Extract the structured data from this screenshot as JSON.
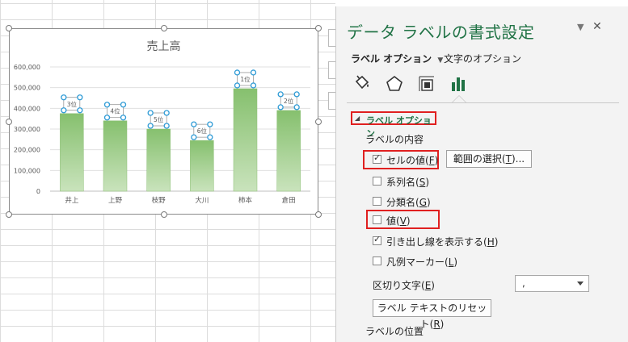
{
  "chart": {
    "title": "売上高",
    "accent": "#9fcd8f"
  },
  "chart_data": {
    "type": "bar",
    "title": "売上高",
    "categories": [
      "井上",
      "上野",
      "枝野",
      "大川",
      "柿本",
      "倉田"
    ],
    "values": [
      375000,
      340000,
      300000,
      245000,
      495000,
      390000
    ],
    "data_labels": [
      "3位",
      "4位",
      "5位",
      "6位",
      "1位",
      "2位"
    ],
    "ylim": [
      0,
      600000
    ],
    "yticks": [
      "0",
      "100,000",
      "200,000",
      "300,000",
      "400,000",
      "500,000",
      "600,000"
    ],
    "xlabel": "",
    "ylabel": "",
    "grid": true,
    "legend": "none"
  },
  "pane": {
    "title": "データ ラベルの書式設定",
    "dropdown_icon": "▼",
    "close_icon": "✕",
    "tab_label_options": "ラベル オプション",
    "tab_text_options": "文字のオプション",
    "icons": [
      "fill-line-icon",
      "effects-pentagon-icon",
      "size-properties-icon",
      "label-options-bar-icon"
    ],
    "section_header": "ラベル オプション",
    "label_contents": "ラベルの内容",
    "cell_value": "セルの値(",
    "cell_value_key": "F",
    "range_button": "範囲の選択(",
    "range_button_key": "T",
    "range_button_tail": ")...",
    "series_name": "系列名(",
    "series_name_key": "S",
    "category_name": "分類名(",
    "category_name_key": "G",
    "value": "値(",
    "value_key": "V",
    "leader_lines": "引き出し線を表示する(",
    "leader_lines_key": "H",
    "legend_key": "凡例マーカー(",
    "legend_key_key": "L",
    "separator": "区切り文字(",
    "separator_key": "E",
    "separator_value": ",",
    "reset_button": "ラベル テキストのリセット(",
    "reset_button_key": "R",
    "label_position": "ラベルの位置",
    "close_paren": ")",
    "checked": {
      "cell_value": true,
      "series_name": false,
      "category_name": false,
      "value": false,
      "leader_lines": true,
      "legend_key": false
    }
  }
}
